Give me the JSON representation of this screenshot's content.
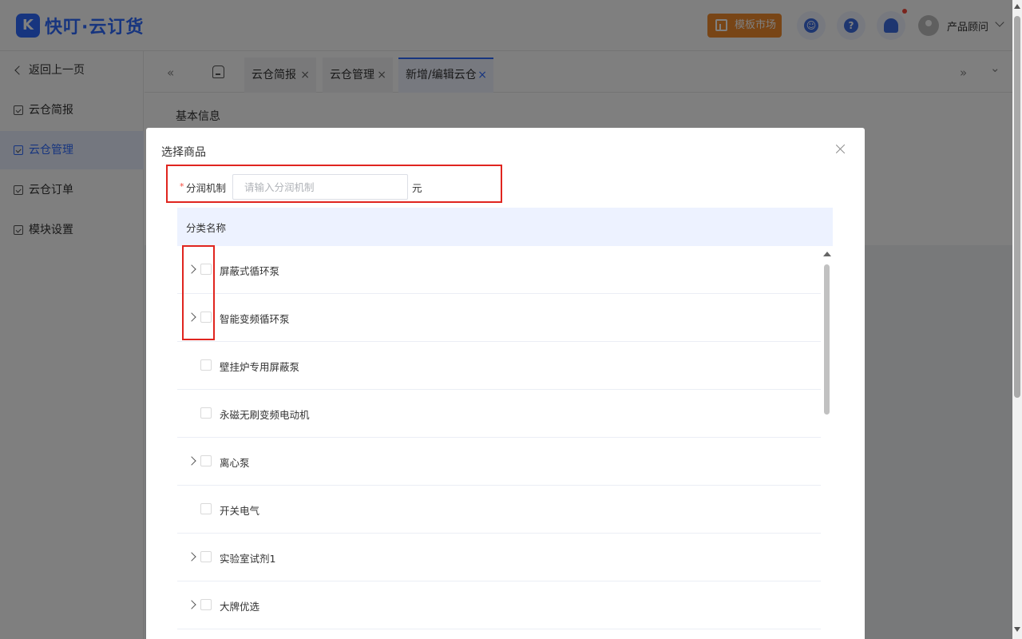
{
  "app": {
    "logo_text": "快叮·云订货",
    "logo_letter": "K"
  },
  "header": {
    "template_market_label": "模板市场",
    "help_label": "?",
    "user_name": "产品顾问"
  },
  "sidebar": {
    "back_label": "返回上一页",
    "items": [
      {
        "label": "云仓简报"
      },
      {
        "label": "云仓管理"
      },
      {
        "label": "云仓订单"
      },
      {
        "label": "模块设置"
      }
    ]
  },
  "tabs": {
    "prev_label": "«",
    "next_label": "»",
    "menu_label": "⌄",
    "items": [
      {
        "label": "云仓简报",
        "close": "×"
      },
      {
        "label": "云仓管理",
        "close": "×"
      },
      {
        "label": "新增/编辑云仓",
        "close": "×"
      }
    ]
  },
  "content": {
    "section_title": "基本信息"
  },
  "modal": {
    "title": "选择商品",
    "field": {
      "required_mark": "*",
      "label": "分润机制",
      "placeholder": "请输入分润机制",
      "value": "",
      "unit": "元"
    },
    "table": {
      "column_header": "分类名称",
      "rows": [
        {
          "name": "屏蔽式循环泵",
          "expandable": true
        },
        {
          "name": "智能变频循环泵",
          "expandable": true
        },
        {
          "name": "壁挂炉专用屏蔽泵",
          "expandable": false
        },
        {
          "name": "永磁无刷变频电动机",
          "expandable": false
        },
        {
          "name": "离心泵",
          "expandable": true
        },
        {
          "name": "开关电气",
          "expandable": false
        },
        {
          "name": "实验室试剂1",
          "expandable": true
        },
        {
          "name": "大牌优选",
          "expandable": true
        }
      ]
    }
  },
  "colors": {
    "brand": "#2f6bff",
    "template_button": "#f08a2c",
    "highlight": "#e0251f"
  }
}
